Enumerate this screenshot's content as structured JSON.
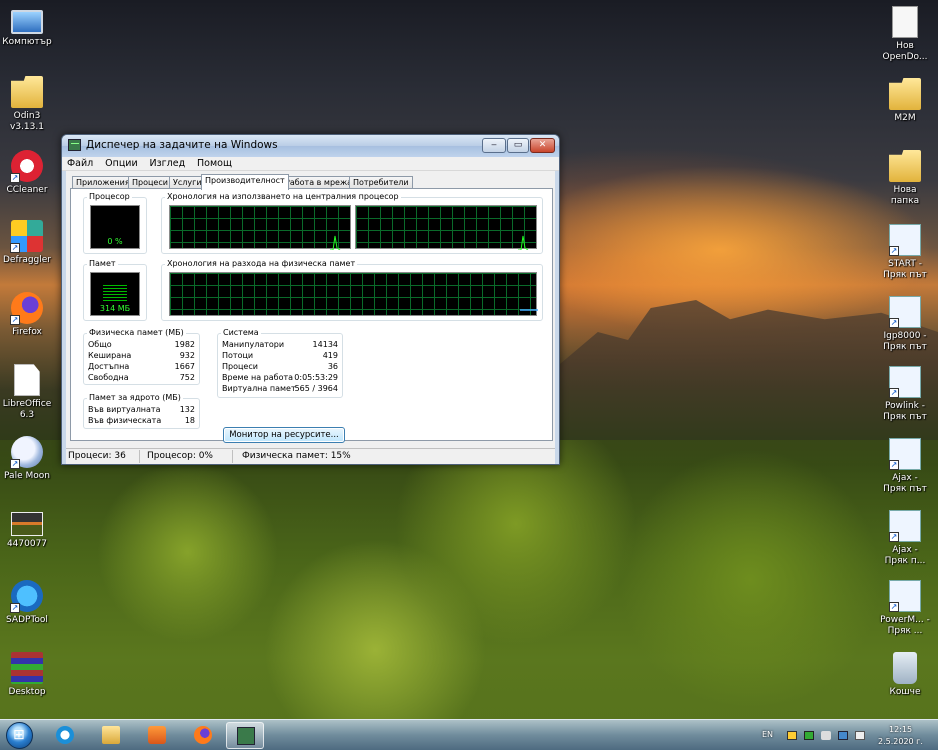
{
  "desktop": {
    "left_icons": [
      {
        "label": "Компютър",
        "icon": "computer-icon"
      },
      {
        "label": "Odin3 v3.13.1",
        "icon": "folder-icon"
      },
      {
        "label": "CCleaner",
        "icon": "ccleaner-icon"
      },
      {
        "label": "Defraggler",
        "icon": "defraggler-icon"
      },
      {
        "label": "Firefox",
        "icon": "firefox-icon"
      },
      {
        "label": "LibreOffice 6.3",
        "icon": "document-icon"
      },
      {
        "label": "Pale Moon",
        "icon": "pale-moon-icon"
      },
      {
        "label": "4470077",
        "icon": "image-icon"
      },
      {
        "label": "SADPTool",
        "icon": "sadp-icon"
      },
      {
        "label": "Desktop",
        "icon": "winrar-icon"
      }
    ],
    "right_icons": [
      {
        "label": "Нов OpenDo...",
        "icon": "document-icon"
      },
      {
        "label": "M2M",
        "icon": "folder-icon"
      },
      {
        "label": "Нова папка",
        "icon": "folder-icon"
      },
      {
        "label": "START - Пряк път",
        "icon": "shortcut-icon"
      },
      {
        "label": "Igp8000 - Пряк път",
        "icon": "shortcut-icon"
      },
      {
        "label": "Powlink - Пряк път",
        "icon": "shortcut-icon"
      },
      {
        "label": "Ajax - Пряк път",
        "icon": "shortcut-icon"
      },
      {
        "label": "Ajax - Пряк п...",
        "icon": "shortcut-icon"
      },
      {
        "label": "PowerM... - Пряк ...",
        "icon": "shortcut-icon"
      },
      {
        "label": "Кошче",
        "icon": "recycle-bin-icon"
      }
    ]
  },
  "window": {
    "title": "Диспечер на задачите на Windows",
    "controls": {
      "minimize": "‒",
      "maximize": "▭",
      "close": "✕"
    },
    "menu": [
      "Файл",
      "Опции",
      "Изглед",
      "Помощ"
    ],
    "tabs": [
      "Приложения",
      "Процеси",
      "Услуги",
      "Производителност",
      "Работа в мрежа",
      "Потребители"
    ],
    "active_tab": "Производителност",
    "cpu": {
      "group_title": "Процесор",
      "value": "0 %",
      "history_title": "Хронология на използването на централния процесор"
    },
    "memory": {
      "group_title": "Памет",
      "value": "314 МБ",
      "history_title": "Хронология на разхода на физическа памет"
    },
    "physical_memory": {
      "title": "Физическа памет (МБ)",
      "rows": [
        {
          "label": "Общо",
          "value": "1982"
        },
        {
          "label": "Кеширана",
          "value": "932"
        },
        {
          "label": "Достъпна",
          "value": "1667"
        },
        {
          "label": "Свободна",
          "value": "752"
        }
      ]
    },
    "kernel_memory": {
      "title": "Памет за ядрото (МБ)",
      "rows": [
        {
          "label": "Във виртуалната",
          "value": "132"
        },
        {
          "label": "Във физическата",
          "value": "18"
        }
      ]
    },
    "system": {
      "title": "Система",
      "rows": [
        {
          "label": "Манипулатори",
          "value": "14134"
        },
        {
          "label": "Потоци",
          "value": "419"
        },
        {
          "label": "Процеси",
          "value": "36"
        },
        {
          "label": "Време на работа",
          "value": "0:05:53:29"
        },
        {
          "label": "Виртуална памет",
          "value": "565 / 3964"
        }
      ]
    },
    "resource_monitor_button": "Монитор на ресурсите...",
    "status": {
      "processes": "Процеси: 36",
      "cpu": "Процесор: 0%",
      "memory": "Физическа памет: 15%"
    }
  },
  "taskbar": {
    "pinned": [
      "start-orb-icon",
      "internet-explorer-icon",
      "explorer-icon",
      "media-player-icon",
      "firefox-icon",
      "task-manager-icon"
    ],
    "tray": {
      "language": "EN",
      "time": "12:15",
      "date": "2.5.2020 г."
    }
  }
}
